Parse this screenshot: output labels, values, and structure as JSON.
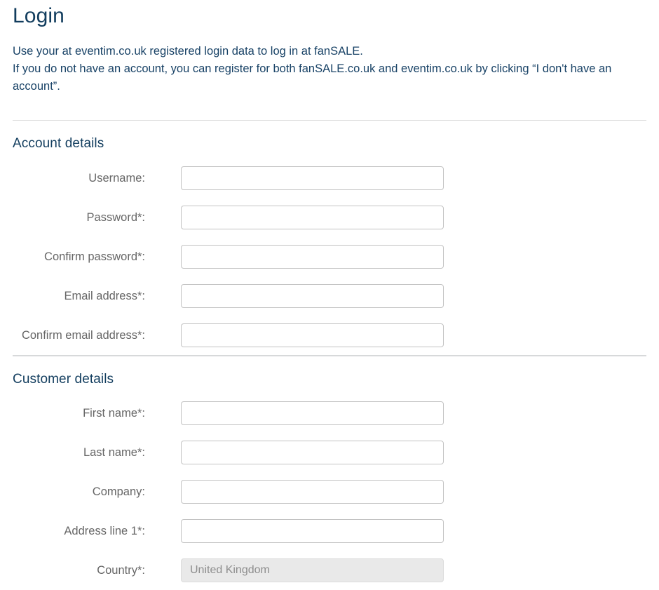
{
  "page": {
    "title": "Login",
    "intro_lines": [
      "Use your at eventim.co.uk registered login data to log in at fanSALE.",
      "If you do not have an account, you can register for both fanSALE.co.uk and eventim.co.uk by clicking “I don't have an",
      "account”."
    ]
  },
  "colors": {
    "heading": "#123d5e",
    "body_text": "#184266",
    "label": "#666666",
    "input_border": "#c3c3c3",
    "readonly_bg": "#e9e9e9",
    "readonly_text": "#8d8d8d",
    "divider": "#dcdcdc",
    "page_bg": "#ffffff"
  },
  "sections": [
    {
      "id": "account-details",
      "heading": "Account details",
      "fields": [
        {
          "id": "username",
          "label": "Username:",
          "value": "",
          "placeholder": "",
          "type": "text",
          "readonly": false
        },
        {
          "id": "password",
          "label": "Password*:",
          "value": "",
          "placeholder": "",
          "type": "password",
          "readonly": false
        },
        {
          "id": "confirm-password",
          "label": "Confirm password*:",
          "value": "",
          "placeholder": "",
          "type": "password",
          "readonly": false
        },
        {
          "id": "email",
          "label": "Email address*:",
          "value": "",
          "placeholder": "",
          "type": "text",
          "readonly": false
        },
        {
          "id": "confirm-email",
          "label": "Confirm email address*:",
          "value": "",
          "placeholder": "",
          "type": "text",
          "readonly": false
        }
      ]
    },
    {
      "id": "customer-details",
      "heading": "Customer details",
      "fields": [
        {
          "id": "first-name",
          "label": "First name*:",
          "value": "",
          "placeholder": "",
          "type": "text",
          "readonly": false
        },
        {
          "id": "last-name",
          "label": "Last name*:",
          "value": "",
          "placeholder": "",
          "type": "text",
          "readonly": false
        },
        {
          "id": "company",
          "label": "Company:",
          "value": "",
          "placeholder": "",
          "type": "text",
          "readonly": false
        },
        {
          "id": "address-line-1",
          "label": "Address line 1*:",
          "value": "",
          "placeholder": "",
          "type": "text",
          "readonly": false
        },
        {
          "id": "country",
          "label": "Country*:",
          "value": "United Kingdom",
          "placeholder": "",
          "type": "text",
          "readonly": true
        }
      ]
    }
  ]
}
